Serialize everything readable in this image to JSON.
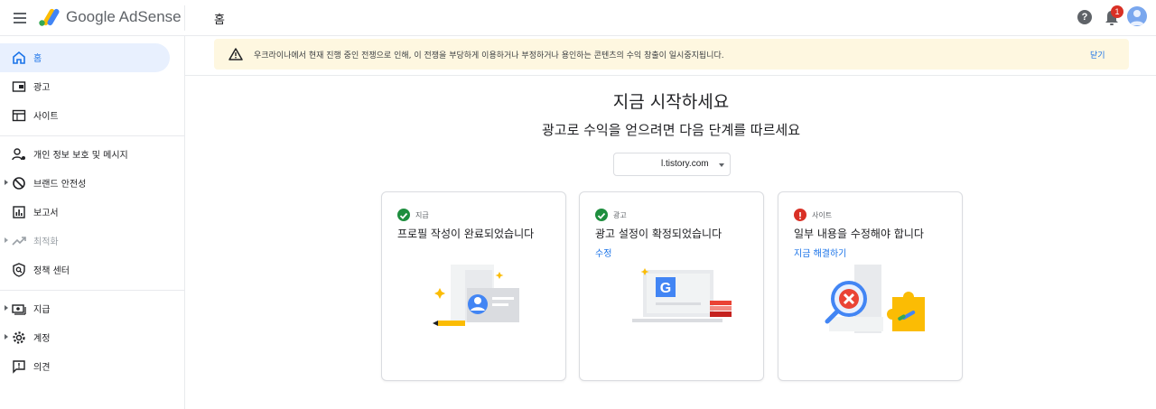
{
  "header": {
    "brand": "Google AdSense",
    "page_crumb": "홈",
    "help_glyph": "?",
    "notification_count": "1"
  },
  "sidebar": {
    "items": [
      {
        "label": "홈",
        "icon": "home-icon"
      },
      {
        "label": "광고",
        "icon": "ads-icon"
      },
      {
        "label": "사이트",
        "icon": "sites-icon"
      },
      {
        "label": "개인 정보 보호 및 메시지",
        "icon": "privacy-icon"
      },
      {
        "label": "브랜드 안전성",
        "icon": "block-icon"
      },
      {
        "label": "보고서",
        "icon": "reports-icon"
      },
      {
        "label": "최적화",
        "icon": "trending-icon"
      },
      {
        "label": "정책 센터",
        "icon": "policy-icon"
      },
      {
        "label": "지급",
        "icon": "payments-icon"
      },
      {
        "label": "계정",
        "icon": "settings-icon"
      },
      {
        "label": "의견",
        "icon": "feedback-icon"
      }
    ]
  },
  "banner": {
    "text": "우크라이나에서 현재 진행 중인 전쟁으로 인해, 이 전쟁을 부당하게 이용하거나 부정하거나 용인하는 콘텐츠의 수익 창출이 일시중지됩니다.",
    "close_label": "닫기",
    "icon": "warning-icon"
  },
  "main": {
    "title": "지금 시작하세요",
    "subtitle": "광고로 수익을 얻으려면 다음 단계를 따르세요",
    "site_select_value": "l.tistory.com"
  },
  "cards": [
    {
      "step": "지급",
      "title": "프로필 작성이 완료되었습니다",
      "link": "",
      "status": "complete"
    },
    {
      "step": "광고",
      "title": "광고 설정이 확정되었습니다",
      "link": "수정",
      "status": "complete"
    },
    {
      "step": "사이트",
      "title": "일부 내용을 수정해야 합니다",
      "link": "지금 해결하기",
      "status": "error"
    }
  ],
  "colors": {
    "accent": "#1a73e8",
    "active_bg": "#e8f0fe",
    "banner_bg": "#fef7e0",
    "success": "#1e8e3e",
    "error": "#d93025",
    "adsense_yellow": "#fbbc04"
  }
}
